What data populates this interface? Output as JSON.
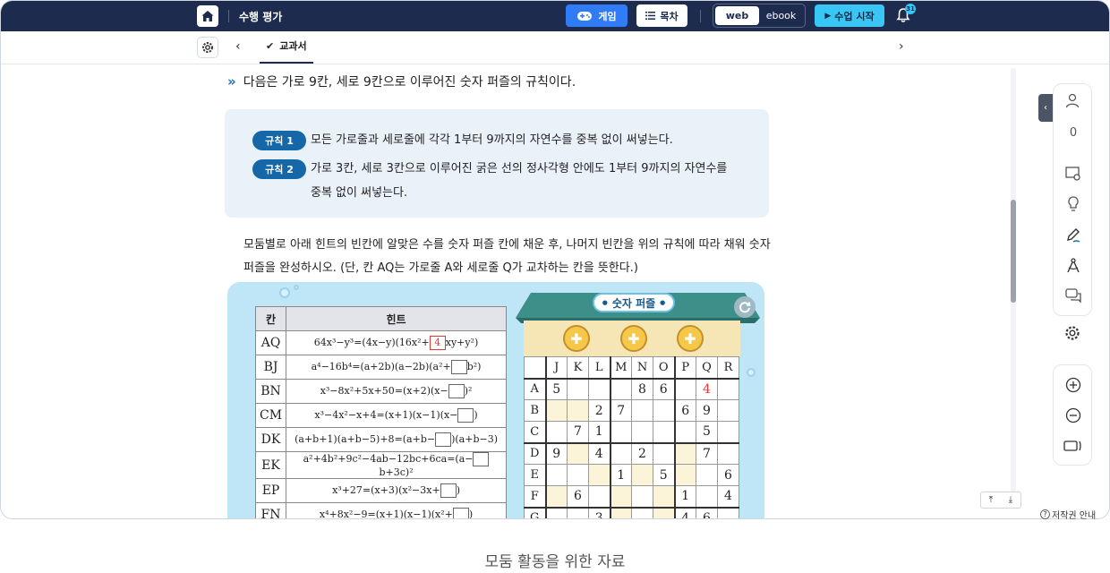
{
  "topbar": {
    "title": "수행 평가",
    "game_label": "게임",
    "toc_label": "목차",
    "view_web": "web",
    "view_ebook": "ebook",
    "start_label": "수업 시작",
    "notification_count": "31"
  },
  "subbar": {
    "tab_label": "교과서"
  },
  "content": {
    "question": "다음은 가로 9칸, 세로 9칸으로 이루어진 숫자 퍼즐의 규칙이다.",
    "rules": [
      {
        "badge": "규칙 1",
        "text": "모든 가로줄과 세로줄에 각각 1부터 9까지의 자연수를 중복 없이 써넣는다."
      },
      {
        "badge": "규칙 2",
        "text": "가로 3칸, 세로 3칸으로 이루어진 굵은 선의 정사각형 안에도 1부터 9까지의 자연수를",
        "text2": "중복 없이 써넣는다."
      }
    ],
    "para1": "모둠별로 아래 힌트의 빈칸에 알맞은 수를 숫자 퍼즐 칸에 채운 후, 나머지 빈칸을 위의 규칙에 따라 채워 숫자",
    "para2": "퍼즐을 완성하시오. (단, 칸 AQ는 가로줄 A와 세로줄 Q가 교차하는 칸을 뜻한다.)"
  },
  "hint_table": {
    "headers": [
      "칸",
      "힌트"
    ],
    "rows": [
      {
        "cell": "AQ",
        "pre": "64x³−y³=(4x−y)(16x²+",
        "box": "4",
        "post": "xy+y²)"
      },
      {
        "cell": "BJ",
        "pre": "a⁴−16b⁴=(a+2b)(a−2b)(a²+",
        "box": "",
        "post": "b²)"
      },
      {
        "cell": "BN",
        "pre": "x³−8x²+5x+50=(x+2)(x−",
        "box": "",
        "post": ")²"
      },
      {
        "cell": "CM",
        "pre": "x³−4x²−x+4=(x+1)(x−1)(x−",
        "box": "",
        "post": ")"
      },
      {
        "cell": "DK",
        "pre": "(a+b+1)(a+b−5)+8=(a+b−",
        "box": "",
        "post": ")(a+b−3)"
      },
      {
        "cell": "EK",
        "pre": "a²+4b²+9c²−4ab−12bc+6ca=(a−",
        "box": "",
        "post": "b+3c)²"
      },
      {
        "cell": "EP",
        "pre": "x³+27=(x+3)(x²−3x+",
        "box": "",
        "post": ")"
      },
      {
        "cell": "FN",
        "pre": "x⁴+8x²−9=(x+1)(x−1)(x²+",
        "box": "",
        "post": ")"
      }
    ]
  },
  "puzzle": {
    "title": "숫자 퍼즐",
    "columns": [
      "J",
      "K",
      "L",
      "M",
      "N",
      "O",
      "P",
      "Q",
      "R"
    ],
    "rows": [
      {
        "label": "A",
        "cells": [
          "5",
          "",
          "",
          "",
          "8",
          "6",
          "",
          "4",
          ""
        ]
      },
      {
        "label": "B",
        "cells": [
          "",
          "",
          "2",
          "7",
          "",
          "",
          "6",
          "9",
          ""
        ]
      },
      {
        "label": "C",
        "cells": [
          "",
          "7",
          "1",
          "",
          "",
          "",
          "",
          "5",
          ""
        ]
      },
      {
        "label": "D",
        "cells": [
          "9",
          "",
          "4",
          "",
          "2",
          "",
          "",
          "7",
          ""
        ]
      },
      {
        "label": "E",
        "cells": [
          "",
          "",
          "",
          "1",
          "",
          "5",
          "",
          "",
          "6"
        ]
      },
      {
        "label": "F",
        "cells": [
          "",
          "6",
          "",
          "",
          "",
          "",
          "1",
          "",
          "4"
        ]
      },
      {
        "label": "G",
        "cells": [
          "",
          "",
          "3",
          "",
          "",
          "",
          "4",
          "6",
          ""
        ]
      }
    ],
    "red_cell": "A-Q"
  },
  "sidebar": {
    "participant_count": "0"
  },
  "footer": {
    "copyright": "저작권 안내",
    "caption": "모둠 활동을 위한 자료"
  },
  "colors": {
    "topbar": "#1d2b4f",
    "game": "#2f7cf6",
    "start": "#39c6f4",
    "rule_badge": "#1567a7",
    "puzzle_bg": "#bfe6f7"
  }
}
